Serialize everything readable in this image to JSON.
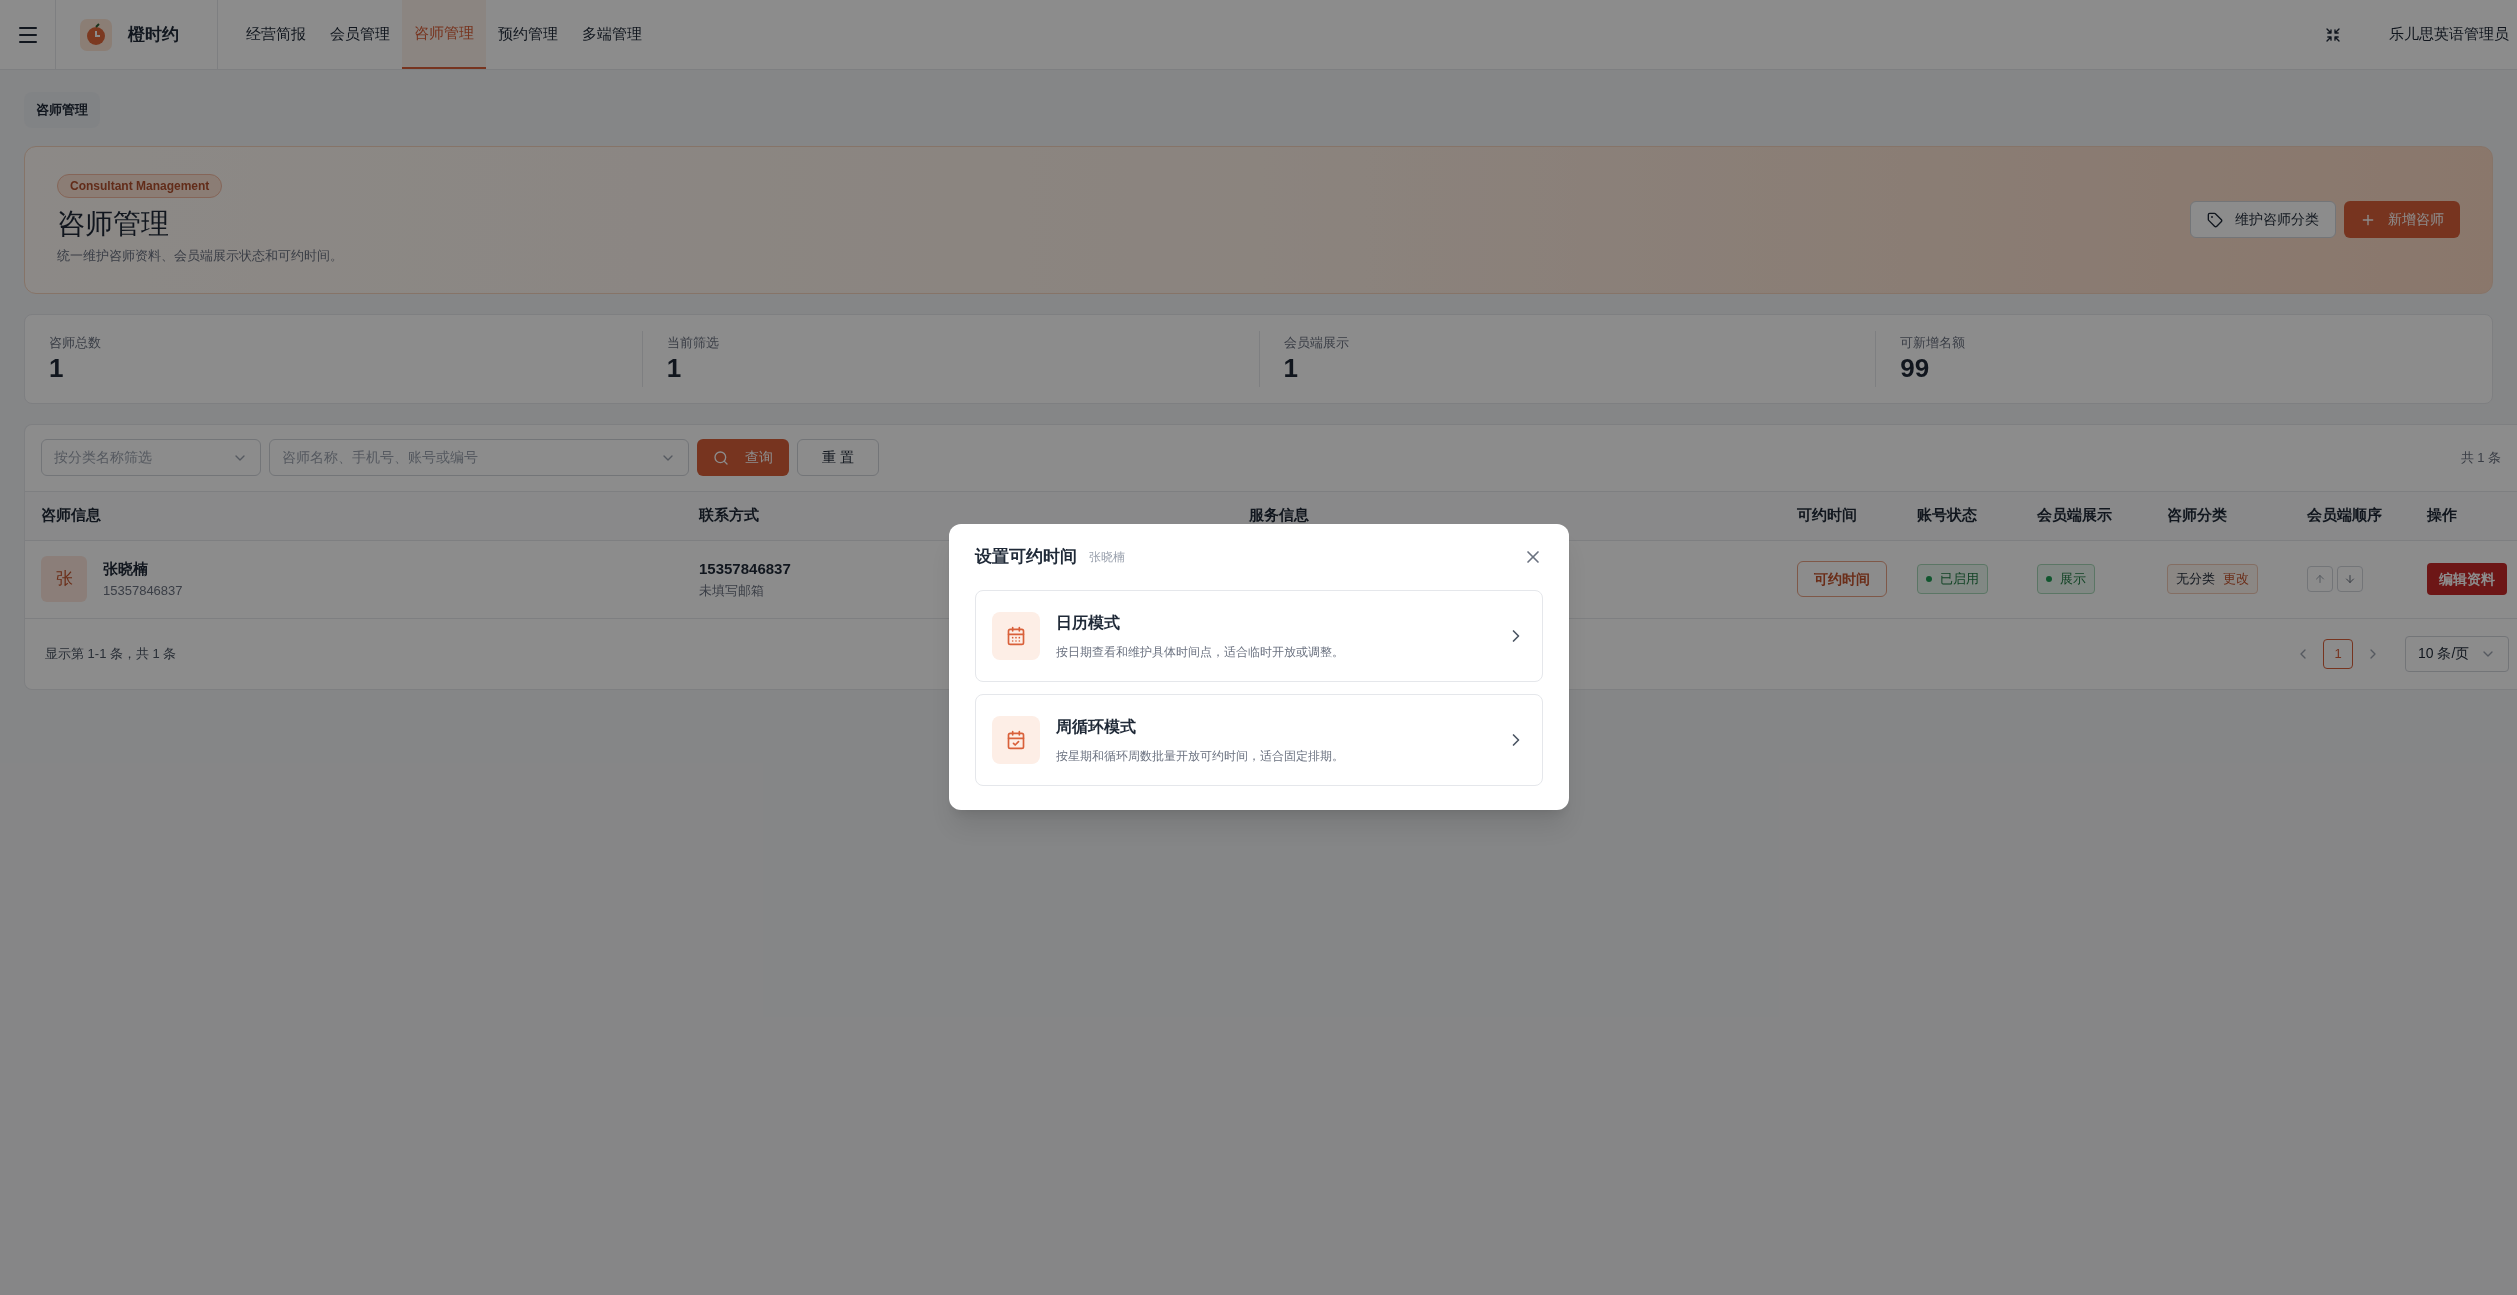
{
  "top_bar": {
    "app_name": "橙时约",
    "nav": [
      {
        "label": "经营简报",
        "selected": false
      },
      {
        "label": "会员管理",
        "selected": false
      },
      {
        "label": "咨师管理",
        "selected": true
      },
      {
        "label": "预约管理",
        "selected": false
      },
      {
        "label": "多端管理",
        "selected": false
      }
    ],
    "user": "乐儿思英语管理员"
  },
  "breadcrumb": "咨师管理",
  "banner": {
    "tag": "Consultant Management",
    "title": "咨师管理",
    "subtitle": "统一维护咨师资料、会员端展示状态和可约时间。",
    "buttons": [
      {
        "label": "维护咨师分类",
        "kind": "secondary"
      },
      {
        "label": "新增咨师",
        "kind": "primary"
      }
    ]
  },
  "stats": [
    {
      "label": "咨师总数",
      "value": "1"
    },
    {
      "label": "当前筛选",
      "value": "1"
    },
    {
      "label": "会员端展示",
      "value": "1"
    },
    {
      "label": "可新增名额",
      "value": "99"
    }
  ],
  "filters": {
    "category_placeholder": "按分类名称筛选",
    "search_placeholder": "咨师名称、手机号、账号或编号",
    "query_button": "查询",
    "reset_button": "重 置",
    "total": "共 1 条"
  },
  "table": {
    "columns": [
      "咨师信息",
      "联系方式",
      "服务信息",
      "可约时间",
      "账号状态",
      "会员端展示",
      "咨师分类",
      "会员端顺序",
      "操作"
    ],
    "rows": [
      {
        "avatar": "张",
        "name": "张晓楠",
        "phone": "15357846837",
        "contact_phone": "15357846837",
        "email": "未填写邮箱",
        "availability_button": "可约时间",
        "status": "已启用",
        "display": "展示",
        "category": "无分类",
        "category_action": "更改",
        "action": "编辑资料"
      }
    ]
  },
  "footer": {
    "summary": "显示第 1-1 条，共 1 条",
    "pages": [
      {
        "label": "1",
        "selected": true
      }
    ],
    "page_size": "10 条/页"
  },
  "modal": {
    "title": "设置可约时间",
    "subtitle": "张晓楠",
    "options": [
      {
        "kind": "calendar",
        "title": "日历模式",
        "description": "按日期查看和维护具体时间点，适合临时开放或调整。"
      },
      {
        "kind": "weekly",
        "title": "周循环模式",
        "description": "按星期和循环周数批量开放可约时间，适合固定排期。"
      }
    ]
  }
}
